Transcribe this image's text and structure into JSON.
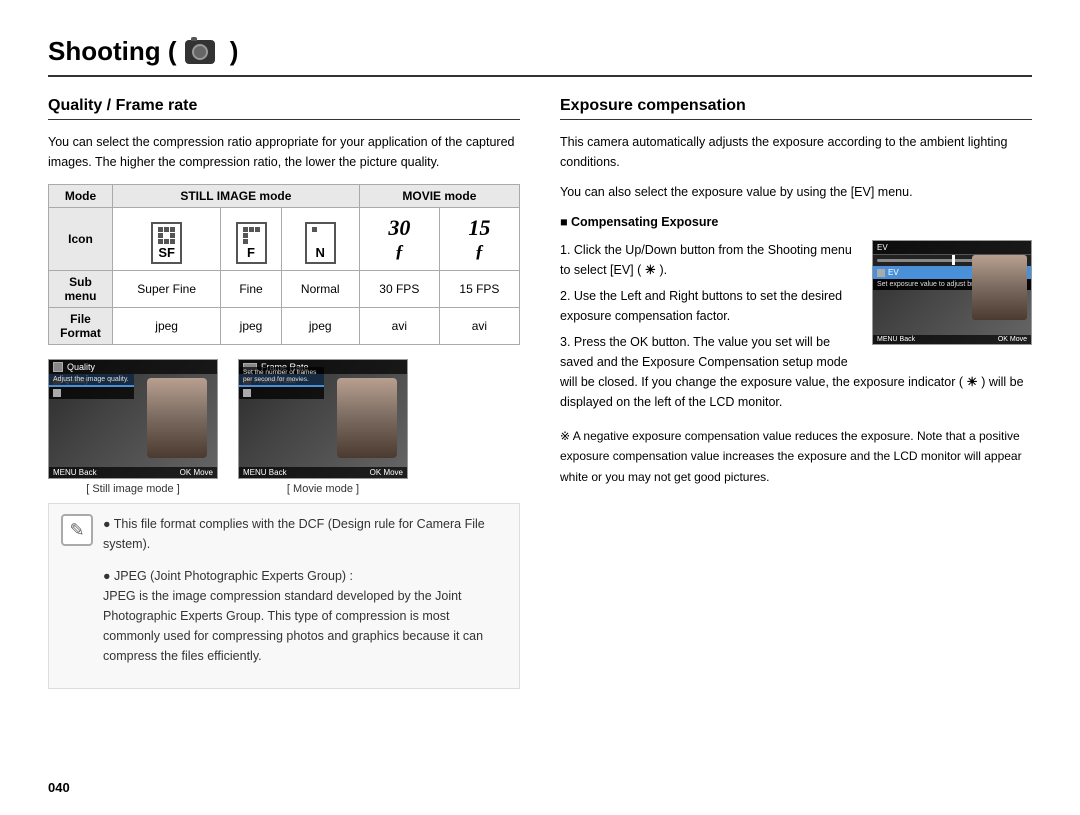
{
  "page": {
    "title": "Shooting (",
    "title_icon": "camera",
    "page_number": "040"
  },
  "left_section": {
    "title": "Quality / Frame rate",
    "description": "You can select the compression ratio appropriate for your application of the captured images. The higher the compression ratio, the lower the picture quality.",
    "table": {
      "headers": [
        "Mode",
        "STILL IMAGE mode",
        "MOVIE mode"
      ],
      "rows": [
        {
          "label": "Icon",
          "cells": [
            "SF_ICON",
            "F_ICON",
            "N_ICON",
            "30FPS_ICON",
            "15FPS_ICON"
          ]
        },
        {
          "label": "Sub menu",
          "cells": [
            "Super Fine",
            "Fine",
            "Normal",
            "30 FPS",
            "15 FPS"
          ]
        },
        {
          "label": "File Format",
          "cells": [
            "jpeg",
            "jpeg",
            "jpeg",
            "avi",
            "avi"
          ]
        }
      ]
    },
    "screenshots": [
      {
        "caption": "[ Still image mode ]",
        "top_label": "Quality",
        "menu_items": [
          "Quality",
          ""
        ],
        "desc": "Adjust the image quality."
      },
      {
        "caption": "[ Movie mode ]",
        "top_label": "Frame Rate",
        "menu_items": [
          "Frame Rate",
          ""
        ],
        "desc": "Set the number of frames per second for movies."
      }
    ],
    "note": {
      "bullets": [
        "This file format complies with the DCF (Design rule for Camera File system).",
        "JPEG (Joint Photographic Experts Group) :\nJPEG is the image compression standard developed by the Joint Photographic Experts Group. This type of compression is most commonly used for compressing photos and graphics because it can compress the files efficiently."
      ]
    }
  },
  "right_section": {
    "title": "Exposure compensation",
    "intro1": "This camera automatically adjusts the exposure according to the ambient lighting conditions.",
    "intro2": "You can also select the exposure value by using the [EV] menu.",
    "compensating_label": "■ Compensating Exposure",
    "steps": [
      "1. Click the Up/Down button from the Shooting menu to select [EV] ( 🔆 ).",
      "2. Use the Left and Right buttons to set the desired exposure compensation factor.",
      "3. Press the OK button. The value you set will be saved and the Exposure Compensation setup mode will be closed. If you change the exposure value, the exposure indicator ( 🔆 ) will be displayed on the left of the LCD monitor."
    ],
    "note_star": "※ A negative exposure compensation value reduces the exposure. Note that a positive exposure compensation value increases the exposure and the LCD monitor will appear white or you may not get good pictures.",
    "screenshot": {
      "top_label": "EV",
      "desc": "Set exposure value to adjust brightness.",
      "bottom_left": "MENU Back",
      "bottom_right": "OK Move"
    }
  }
}
